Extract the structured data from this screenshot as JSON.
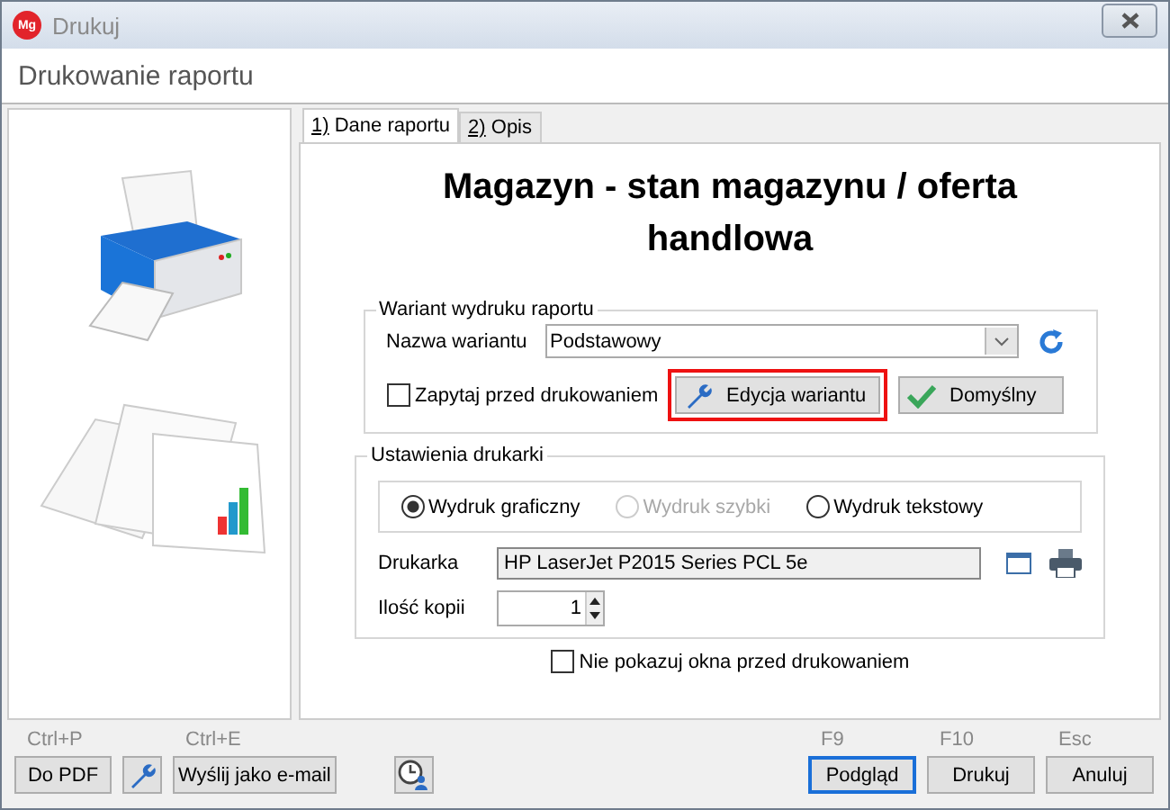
{
  "window": {
    "logo": "Mg",
    "title": "Drukuj"
  },
  "header": {
    "title": "Drukowanie raportu"
  },
  "tabs": [
    {
      "label": "1) Dane raportu",
      "selected": true
    },
    {
      "label": "2) Opis",
      "selected": false
    }
  ],
  "report_title": "Magazyn - stan magazynu / oferta handlowa",
  "variant_group": {
    "legend": "Wariant wydruku raportu",
    "name_label": "Nazwa wariantu",
    "name_value": "Podstawowy",
    "ask_before_print": {
      "label": "Zapytaj przed drukowaniem",
      "checked": false
    },
    "buttons": [
      {
        "kind": "edit",
        "label": "Edycja wariantu",
        "highlighted": true
      },
      {
        "kind": "default",
        "label": "Domyślny",
        "highlighted": false
      }
    ]
  },
  "printer_group": {
    "legend": "Ustawienia drukarki",
    "modes": [
      {
        "label": "Wydruk graficzny",
        "selected": true,
        "disabled": false
      },
      {
        "label": "Wydruk szybki",
        "selected": false,
        "disabled": true
      },
      {
        "label": "Wydruk tekstowy",
        "selected": false,
        "disabled": false
      }
    ],
    "printer_label": "Drukarka",
    "printer_value": "HP LaserJet P2015 Series PCL 5e",
    "copies_label": "Ilość kopii",
    "copies_value": "1"
  },
  "hide_window": {
    "label": "Nie pokazuj okna przed drukowaniem",
    "checked": false
  },
  "footer": {
    "left": [
      {
        "kind": "button",
        "shortcut": "Ctrl+P",
        "label": "Do PDF"
      },
      {
        "kind": "wrench"
      },
      {
        "kind": "button",
        "shortcut": "Ctrl+E",
        "label": "Wyślij jako e-mail"
      },
      {
        "kind": "clock"
      }
    ],
    "right": [
      {
        "shortcut": "F9",
        "label": "Podgląd",
        "focused": true
      },
      {
        "shortcut": "F10",
        "label": "Drukuj",
        "focused": false
      },
      {
        "shortcut": "Esc",
        "label": "Anuluj",
        "focused": false
      }
    ]
  }
}
